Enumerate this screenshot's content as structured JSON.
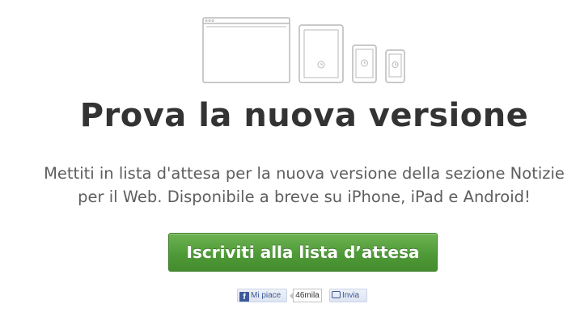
{
  "header": {
    "title": "Prova la nuova versione",
    "description_line1": "Mettiti in lista d'attesa per la nuova versione della sezione Notizie",
    "description_line2": "per il Web. Disponibile a breve su iPhone, iPad e Android!"
  },
  "devices": {
    "icons": [
      "browser-window-icon",
      "tablet-icon",
      "phone-icon",
      "small-phone-icon"
    ]
  },
  "cta": {
    "label": "Iscriviti alla lista d’attesa",
    "color": "#4f9a38"
  },
  "social": {
    "like_label": "Mi piace",
    "like_count": "46mila",
    "send_label": "Invia",
    "brand_color": "#3b5998"
  }
}
